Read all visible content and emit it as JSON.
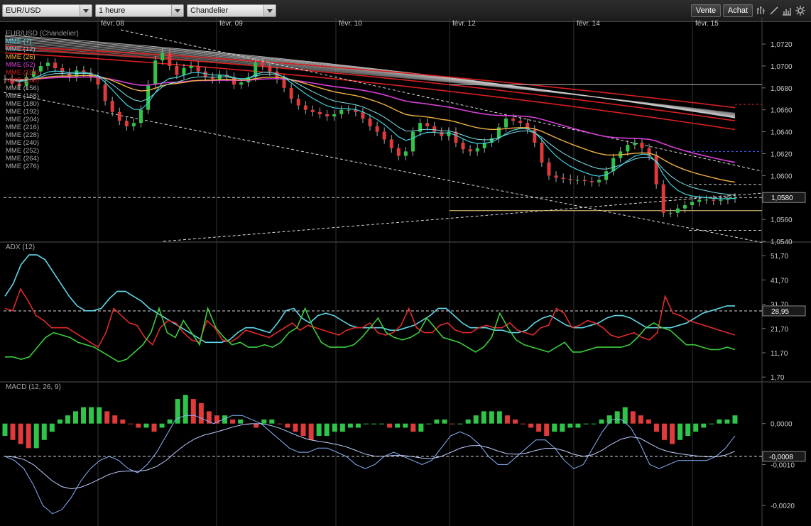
{
  "toolbar": {
    "symbol": "EUR/USD",
    "interval": "1 heure",
    "chart_type": "Chandelier",
    "sell_label": "Vente",
    "buy_label": "Achat",
    "icons": [
      "bar-chart-icon",
      "line-draw-icon",
      "chart-type-icon",
      "settings-icon"
    ]
  },
  "colors": {
    "background": "#000000",
    "grid": "#1c1c1c",
    "up_candle": "#2ec54a",
    "down_candle": "#e03a3a",
    "mme7": "#3fd4e0",
    "mme26": "#f1b143",
    "mme52": "#d63fd6",
    "mme_long": "#d81f1f",
    "adx": "#5fd7e8",
    "di_minus": "#e02b2b",
    "di_plus": "#3ccd3c",
    "macd_line": "#8ab4ff"
  },
  "chart_data": [
    {
      "type": "candlestick",
      "title": "EUR/USD (Chandelier)",
      "x_tick_labels": [
        "févr. 08",
        "févr. 09",
        "févr. 10",
        "févr. 12",
        "févr. 14",
        "févr. 15"
      ],
      "y_tick_labels": [
        "1,0720",
        "1,0700",
        "1,0680",
        "1,0660",
        "1,0640",
        "1,0620",
        "1,0600",
        "1,0580",
        "1,0560",
        "1,0540"
      ],
      "ylim": [
        1.054,
        1.0733
      ],
      "last_price": "1,0580",
      "legend": [
        "MME (7)",
        "MME (12)",
        "MME (26)",
        "MME (52)",
        "MME (104)",
        "MME (208)",
        "MME (156)",
        "MME (168)",
        "MME (180)",
        "MME (192)",
        "MME (204)",
        "MME (216)",
        "MME (228)",
        "MME (240)",
        "MME (252)",
        "MME (264)",
        "MME (276)"
      ],
      "legend_visible": [
        "MME (7)",
        "MME (12)",
        "MME (26)",
        "MME (52)",
        "MME (104)",
        "MME (208)",
        "MME (156)",
        "MME (168)",
        "MME (180)",
        "MME (192)",
        "MME (204)",
        "MME (216)",
        "MME (228)",
        "MME (240)",
        "MME (252)",
        "MME (264)",
        "MME (276)"
      ],
      "close_path": [
        1.0688,
        1.0684,
        1.0682,
        1.069,
        1.0695,
        1.07,
        1.0703,
        1.0698,
        1.0694,
        1.069,
        1.0696,
        1.0694,
        1.069,
        1.0683,
        1.0668,
        1.0658,
        1.065,
        1.0645,
        1.0648,
        1.066,
        1.0683,
        1.0705,
        1.0712,
        1.07,
        1.0692,
        1.0698,
        1.07,
        1.0695,
        1.069,
        1.0688,
        1.0692,
        1.069,
        1.0683,
        1.0685,
        1.069,
        1.0703,
        1.07,
        1.0695,
        1.0688,
        1.068,
        1.067,
        1.0664,
        1.066,
        1.0658,
        1.0656,
        1.0654,
        1.0656,
        1.066,
        1.066,
        1.0658,
        1.0652,
        1.0645,
        1.064,
        1.0633,
        1.0625,
        1.0618,
        1.0622,
        1.064,
        1.0648,
        1.0645,
        1.064,
        1.0636,
        1.064,
        1.063,
        1.0624,
        1.0622,
        1.0625,
        1.063,
        1.0634,
        1.0644,
        1.0652,
        1.065,
        1.0648,
        1.0642,
        1.063,
        1.0612,
        1.06,
        1.0598,
        1.0597,
        1.0596,
        1.0596,
        1.0595,
        1.0594,
        1.0596,
        1.0604,
        1.0616,
        1.0622,
        1.0628,
        1.063,
        1.0625,
        1.0618,
        1.0592,
        1.0566,
        1.0566,
        1.057,
        1.0573,
        1.0576,
        1.0578,
        1.0578,
        1.0577,
        1.0578,
        1.0579,
        1.058
      ],
      "reference_lines": [
        1.0683,
        1.0622,
        1.0592,
        1.058,
        1.0568,
        1.055
      ]
    },
    {
      "type": "line",
      "title": "ADX (12)",
      "y_tick_labels": [
        "51,70",
        "41,70",
        "31,70",
        "21,70",
        "11,70",
        "1,70"
      ],
      "ylim": [
        0,
        57
      ],
      "last_value": "28,95",
      "series": [
        {
          "name": "ADX (12)",
          "values": [
            35,
            40,
            48,
            52,
            52,
            50,
            45,
            40,
            35,
            31,
            29,
            29,
            30,
            34,
            37,
            37,
            35,
            33,
            30,
            28,
            26,
            24,
            22,
            20,
            18,
            16,
            16,
            16,
            17,
            20,
            22,
            22,
            21,
            20,
            24,
            29,
            30,
            26,
            24,
            27,
            28,
            27,
            25,
            23,
            22,
            22,
            22,
            22,
            21,
            21,
            22,
            23,
            25,
            27,
            30,
            30,
            27,
            24,
            22,
            22,
            22,
            21,
            21,
            20,
            20,
            21,
            24,
            26,
            27,
            25,
            23,
            22,
            22,
            23,
            24,
            26,
            27,
            27,
            26,
            24,
            22,
            22,
            22,
            22,
            23,
            24,
            26,
            28,
            29,
            30,
            31,
            31
          ]
        },
        {
          "name": "-DI",
          "values": [
            30,
            29,
            38,
            33,
            27,
            25,
            22,
            22,
            22,
            20,
            18,
            16,
            14,
            20,
            30,
            27,
            24,
            23,
            18,
            15,
            22,
            25,
            24,
            20,
            17,
            16,
            25,
            22,
            17,
            16,
            18,
            21,
            20,
            19,
            18,
            20,
            22,
            24,
            21,
            23,
            22,
            21,
            20,
            19,
            21,
            22,
            22,
            24,
            20,
            19,
            20,
            23,
            30,
            22,
            20,
            20,
            23,
            24,
            21,
            20,
            20,
            22,
            23,
            22,
            22,
            24,
            21,
            20,
            19,
            22,
            23,
            30,
            28,
            22,
            23,
            25,
            24,
            22,
            19,
            18,
            19,
            20,
            18,
            17,
            20,
            35,
            28,
            27,
            25,
            24,
            23,
            22,
            21,
            20,
            19
          ]
        },
        {
          "name": "+DI",
          "values": [
            10,
            10,
            9,
            10,
            14,
            18,
            20,
            19,
            18,
            16,
            15,
            14,
            12,
            10,
            8,
            9,
            12,
            15,
            20,
            30,
            20,
            18,
            25,
            20,
            15,
            30,
            22,
            18,
            15,
            16,
            14,
            14,
            15,
            14,
            16,
            20,
            22,
            30,
            22,
            16,
            14,
            14,
            14,
            15,
            18,
            22,
            26,
            20,
            18,
            17,
            18,
            20,
            26,
            22,
            18,
            17,
            16,
            14,
            12,
            14,
            18,
            28,
            22,
            17,
            15,
            14,
            13,
            12,
            14,
            16,
            12,
            12,
            13,
            14,
            14,
            14,
            14,
            15,
            18,
            22,
            24,
            22,
            21,
            18,
            15,
            15,
            14,
            13,
            13,
            14,
            13
          ]
        }
      ]
    },
    {
      "type": "bar",
      "title": "MACD (12, 26, 9)",
      "y_tick_labels": [
        "0,0000",
        "-0,0010",
        "-0,0020"
      ],
      "ylim": [
        -0.0025,
        0.001
      ],
      "last_value": "-0,0008",
      "histogram": [
        -0.0003,
        -0.0004,
        -0.0005,
        -0.0006,
        -0.0006,
        -0.0004,
        -0.0002,
        0.0001,
        0.0002,
        0.0003,
        0.0004,
        0.0004,
        0.0004,
        0.0003,
        0.0002,
        0.0001,
        0.0,
        -0.0001,
        -0.0001,
        -0.0002,
        -0.0001,
        0.0001,
        0.0006,
        0.0007,
        0.0006,
        0.0005,
        0.0003,
        0.0002,
        0.0002,
        0.0001,
        0.0001,
        0.0,
        -0.0001,
        0.0001,
        0.0001,
        0.0,
        -0.0001,
        -0.0002,
        -0.0003,
        -0.0004,
        -0.0003,
        -0.0003,
        -0.0002,
        -0.0002,
        -0.0001,
        -0.0001,
        0.0,
        0.0,
        0.0,
        -0.0001,
        -0.0001,
        -0.0001,
        -0.0002,
        -0.0002,
        0.0,
        0.0001,
        0.0001,
        0.0,
        0.0,
        0.0001,
        0.0002,
        0.0003,
        0.0003,
        0.0003,
        0.0002,
        0.0001,
        0.0,
        -0.0001,
        -0.0002,
        -0.0003,
        -0.0002,
        -0.0002,
        -0.0001,
        -0.0001,
        0.0,
        0.0,
        0.0001,
        0.0002,
        0.0003,
        0.0004,
        0.0003,
        0.0002,
        0.0001,
        -0.0002,
        -0.0004,
        -0.0005,
        -0.0004,
        -0.0003,
        -0.0002,
        -0.0001,
        0.0,
        0.0001,
        0.0001,
        0.0002
      ],
      "macd": [
        -0.0008,
        -0.0009,
        -0.0011,
        -0.0015,
        -0.002,
        -0.0022,
        -0.0021,
        -0.0018,
        -0.0014,
        -0.0011,
        -0.0009,
        -0.0008,
        -0.0009,
        -0.0011,
        -0.0012,
        -0.001,
        -0.0007,
        -0.0003,
        0.0001,
        0.0002,
        0.0002,
        0.0001,
        0.0,
        0.0001,
        0.0002,
        0.0002,
        0.0001,
        0.0,
        -0.0002,
        -0.0004,
        -0.0006,
        -0.0007,
        -0.0007,
        -0.0006,
        -0.0006,
        -0.0007,
        -0.0008,
        -0.001,
        -0.0011,
        -0.001,
        -0.0008,
        -0.0007,
        -0.0008,
        -0.0009,
        -0.001,
        -0.0009,
        -0.0006,
        -0.0003,
        -0.0002,
        -0.0003,
        -0.0005,
        -0.0008,
        -0.001,
        -0.001,
        -0.0008,
        -0.0006,
        -0.0004,
        -0.0004,
        -0.0006,
        -0.0009,
        -0.0011,
        -0.001,
        -0.0006,
        -0.0002,
        0.0001,
        0.0001,
        -0.0001,
        -0.0005,
        -0.001,
        -0.0011,
        -0.001,
        -0.0009,
        -0.0009,
        -0.0009,
        -0.0009,
        -0.0008,
        -0.0006,
        -0.0003
      ]
    }
  ]
}
